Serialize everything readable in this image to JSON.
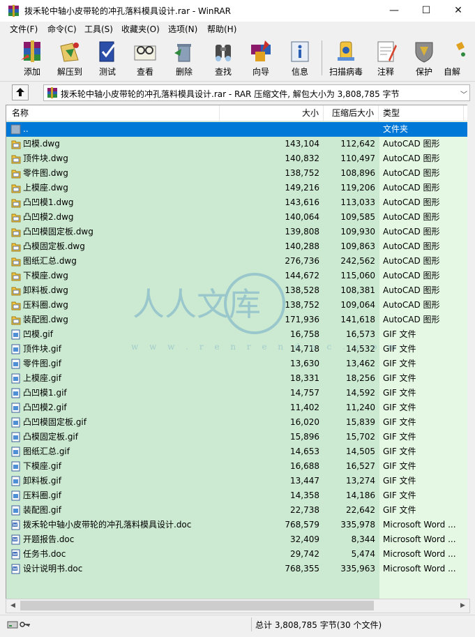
{
  "window": {
    "title": "拨禾轮中轴小皮带轮的冲孔落料模具设计.rar - WinRAR",
    "minimize": "—",
    "maximize": "☐",
    "close": "✕"
  },
  "menu": [
    "文件(F)",
    "命令(C)",
    "工具(S)",
    "收藏夹(O)",
    "选项(N)",
    "帮助(H)"
  ],
  "toolbar": [
    {
      "label": "添加",
      "icon": "add-archive-icon"
    },
    {
      "label": "解压到",
      "icon": "extract-to-icon"
    },
    {
      "label": "测试",
      "icon": "test-icon"
    },
    {
      "label": "查看",
      "icon": "view-icon"
    },
    {
      "label": "删除",
      "icon": "delete-icon"
    },
    {
      "label": "查找",
      "icon": "find-icon"
    },
    {
      "label": "向导",
      "icon": "wizard-icon"
    },
    {
      "label": "信息",
      "icon": "info-icon"
    },
    {
      "label": "扫描病毒",
      "icon": "virus-scan-icon"
    },
    {
      "label": "注释",
      "icon": "comment-icon"
    },
    {
      "label": "保护",
      "icon": "protect-icon"
    },
    {
      "label": "自解",
      "icon": "sfx-icon"
    }
  ],
  "address": {
    "path": "拨禾轮中轴小皮带轮的冲孔落料模具设计.rar - RAR 压缩文件, 解包大小为 3,808,785 字节"
  },
  "columns": {
    "name": "名称",
    "size": "大小",
    "packed": "压缩后大小",
    "type": "类型"
  },
  "files": [
    {
      "name": "..",
      "size": "",
      "packed": "",
      "type": "文件夹",
      "icon": "folder-up-icon",
      "selected": true
    },
    {
      "name": "凹模.dwg",
      "size": "143,104",
      "packed": "112,642",
      "type": "AutoCAD 图形",
      "icon": "dwg-file-icon"
    },
    {
      "name": "顶件块.dwg",
      "size": "140,832",
      "packed": "110,497",
      "type": "AutoCAD 图形",
      "icon": "dwg-file-icon"
    },
    {
      "name": "零件图.dwg",
      "size": "138,752",
      "packed": "108,896",
      "type": "AutoCAD 图形",
      "icon": "dwg-file-icon"
    },
    {
      "name": "上模座.dwg",
      "size": "149,216",
      "packed": "119,206",
      "type": "AutoCAD 图形",
      "icon": "dwg-file-icon"
    },
    {
      "name": "凸凹模1.dwg",
      "size": "143,616",
      "packed": "113,033",
      "type": "AutoCAD 图形",
      "icon": "dwg-file-icon"
    },
    {
      "name": "凸凹模2.dwg",
      "size": "140,064",
      "packed": "109,585",
      "type": "AutoCAD 图形",
      "icon": "dwg-file-icon"
    },
    {
      "name": "凸凹模固定板.dwg",
      "size": "139,808",
      "packed": "109,930",
      "type": "AutoCAD 图形",
      "icon": "dwg-file-icon"
    },
    {
      "name": "凸模固定板.dwg",
      "size": "140,288",
      "packed": "109,863",
      "type": "AutoCAD 图形",
      "icon": "dwg-file-icon"
    },
    {
      "name": "图纸汇总.dwg",
      "size": "276,736",
      "packed": "242,562",
      "type": "AutoCAD 图形",
      "icon": "dwg-file-icon"
    },
    {
      "name": "下模座.dwg",
      "size": "144,672",
      "packed": "115,060",
      "type": "AutoCAD 图形",
      "icon": "dwg-file-icon"
    },
    {
      "name": "卸料板.dwg",
      "size": "138,528",
      "packed": "108,381",
      "type": "AutoCAD 图形",
      "icon": "dwg-file-icon"
    },
    {
      "name": "压料圈.dwg",
      "size": "138,752",
      "packed": "109,064",
      "type": "AutoCAD 图形",
      "icon": "dwg-file-icon"
    },
    {
      "name": "装配图.dwg",
      "size": "171,936",
      "packed": "141,618",
      "type": "AutoCAD 图形",
      "icon": "dwg-file-icon"
    },
    {
      "name": "凹模.gif",
      "size": "16,758",
      "packed": "16,573",
      "type": "GIF 文件",
      "icon": "gif-file-icon"
    },
    {
      "name": "顶件块.gif",
      "size": "14,718",
      "packed": "14,532",
      "type": "GIF 文件",
      "icon": "gif-file-icon"
    },
    {
      "name": "零件图.gif",
      "size": "13,630",
      "packed": "13,462",
      "type": "GIF 文件",
      "icon": "gif-file-icon"
    },
    {
      "name": "上模座.gif",
      "size": "18,331",
      "packed": "18,256",
      "type": "GIF 文件",
      "icon": "gif-file-icon"
    },
    {
      "name": "凸凹模1.gif",
      "size": "14,757",
      "packed": "14,592",
      "type": "GIF 文件",
      "icon": "gif-file-icon"
    },
    {
      "name": "凸凹模2.gif",
      "size": "11,402",
      "packed": "11,240",
      "type": "GIF 文件",
      "icon": "gif-file-icon"
    },
    {
      "name": "凸凹模固定板.gif",
      "size": "16,020",
      "packed": "15,839",
      "type": "GIF 文件",
      "icon": "gif-file-icon"
    },
    {
      "name": "凸模固定板.gif",
      "size": "15,896",
      "packed": "15,702",
      "type": "GIF 文件",
      "icon": "gif-file-icon"
    },
    {
      "name": "图纸汇总.gif",
      "size": "14,653",
      "packed": "14,505",
      "type": "GIF 文件",
      "icon": "gif-file-icon"
    },
    {
      "name": "下模座.gif",
      "size": "16,688",
      "packed": "16,527",
      "type": "GIF 文件",
      "icon": "gif-file-icon"
    },
    {
      "name": "卸料板.gif",
      "size": "13,447",
      "packed": "13,274",
      "type": "GIF 文件",
      "icon": "gif-file-icon"
    },
    {
      "name": "压料圈.gif",
      "size": "14,358",
      "packed": "14,186",
      "type": "GIF 文件",
      "icon": "gif-file-icon"
    },
    {
      "name": "装配图.gif",
      "size": "22,738",
      "packed": "22,642",
      "type": "GIF 文件",
      "icon": "gif-file-icon"
    },
    {
      "name": "拨禾轮中轴小皮带轮的冲孔落料模具设计.doc",
      "size": "768,579",
      "packed": "335,978",
      "type": "Microsoft Word ...",
      "icon": "doc-file-icon"
    },
    {
      "name": "开题报告.doc",
      "size": "32,409",
      "packed": "8,344",
      "type": "Microsoft Word ...",
      "icon": "doc-file-icon"
    },
    {
      "name": "任务书.doc",
      "size": "29,742",
      "packed": "5,474",
      "type": "Microsoft Word ...",
      "icon": "doc-file-icon"
    },
    {
      "name": "设计说明书.doc",
      "size": "768,355",
      "packed": "335,963",
      "type": "Microsoft Word ...",
      "icon": "doc-file-icon"
    }
  ],
  "status": {
    "summary": "总计 3,808,785 字节(30 个文件)"
  },
  "watermark": {
    "text": "人人文库",
    "url": "w w w . r e n r e n d o c . c o m"
  }
}
